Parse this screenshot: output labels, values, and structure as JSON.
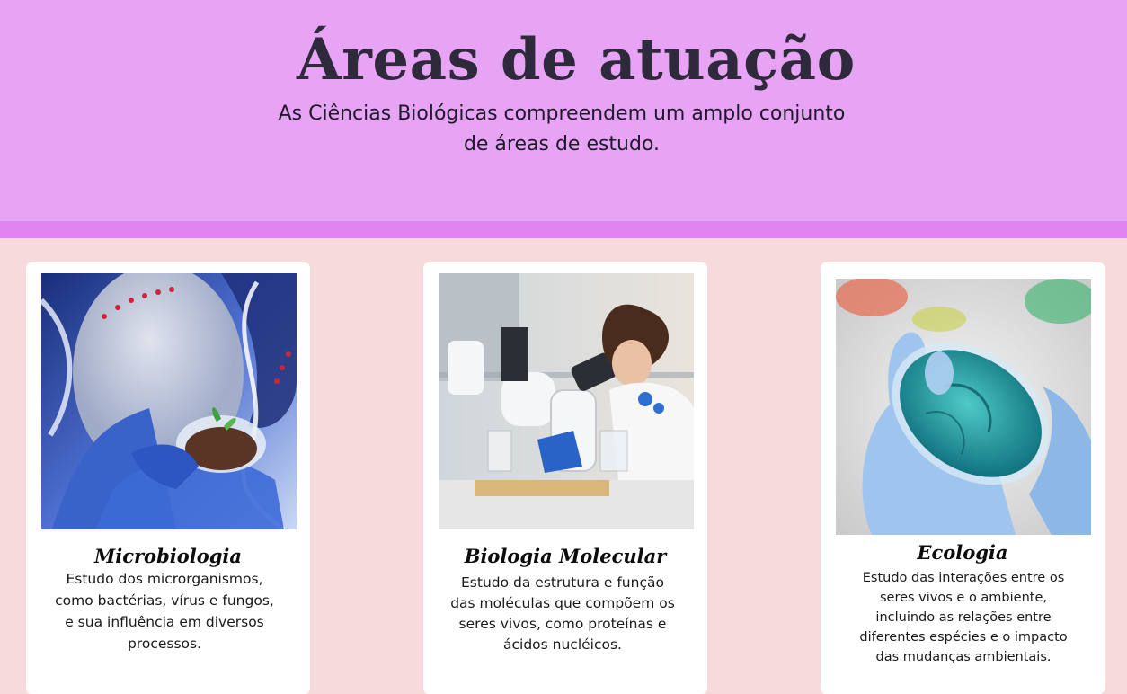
{
  "header": {
    "title": "Áreas de atuação",
    "subtitle": "As Ciências Biológicas compreendem um amplo conjunto de áreas de estudo."
  },
  "cards": [
    {
      "title": "Microbiologia",
      "text": "Estudo dos microrganismos, como bactérias, vírus e fungos, e sua influência em diversos processos.",
      "image_icon": "petri-dish-soil-photo"
    },
    {
      "title": "Biologia Molecular",
      "text": "Estudo da estrutura e função das moléculas que compõem os seres vivos, como proteínas e ácidos nucléicos.",
      "image_icon": "scientist-microscope-photo"
    },
    {
      "title": "Ecologia",
      "text": "Estudo das interações entre os seres vivos e o ambiente, incluindo as relações entre diferentes espécies e o impacto das mudanças ambientais.",
      "image_icon": "blue-petri-dish-photo"
    }
  ],
  "colors": {
    "hero_bg": "#e8a4f4",
    "hero_stripe": "#e283f2",
    "page_bg": "#f6dadc",
    "card_bg": "#ffffff",
    "title_color": "#2f2a3b"
  }
}
